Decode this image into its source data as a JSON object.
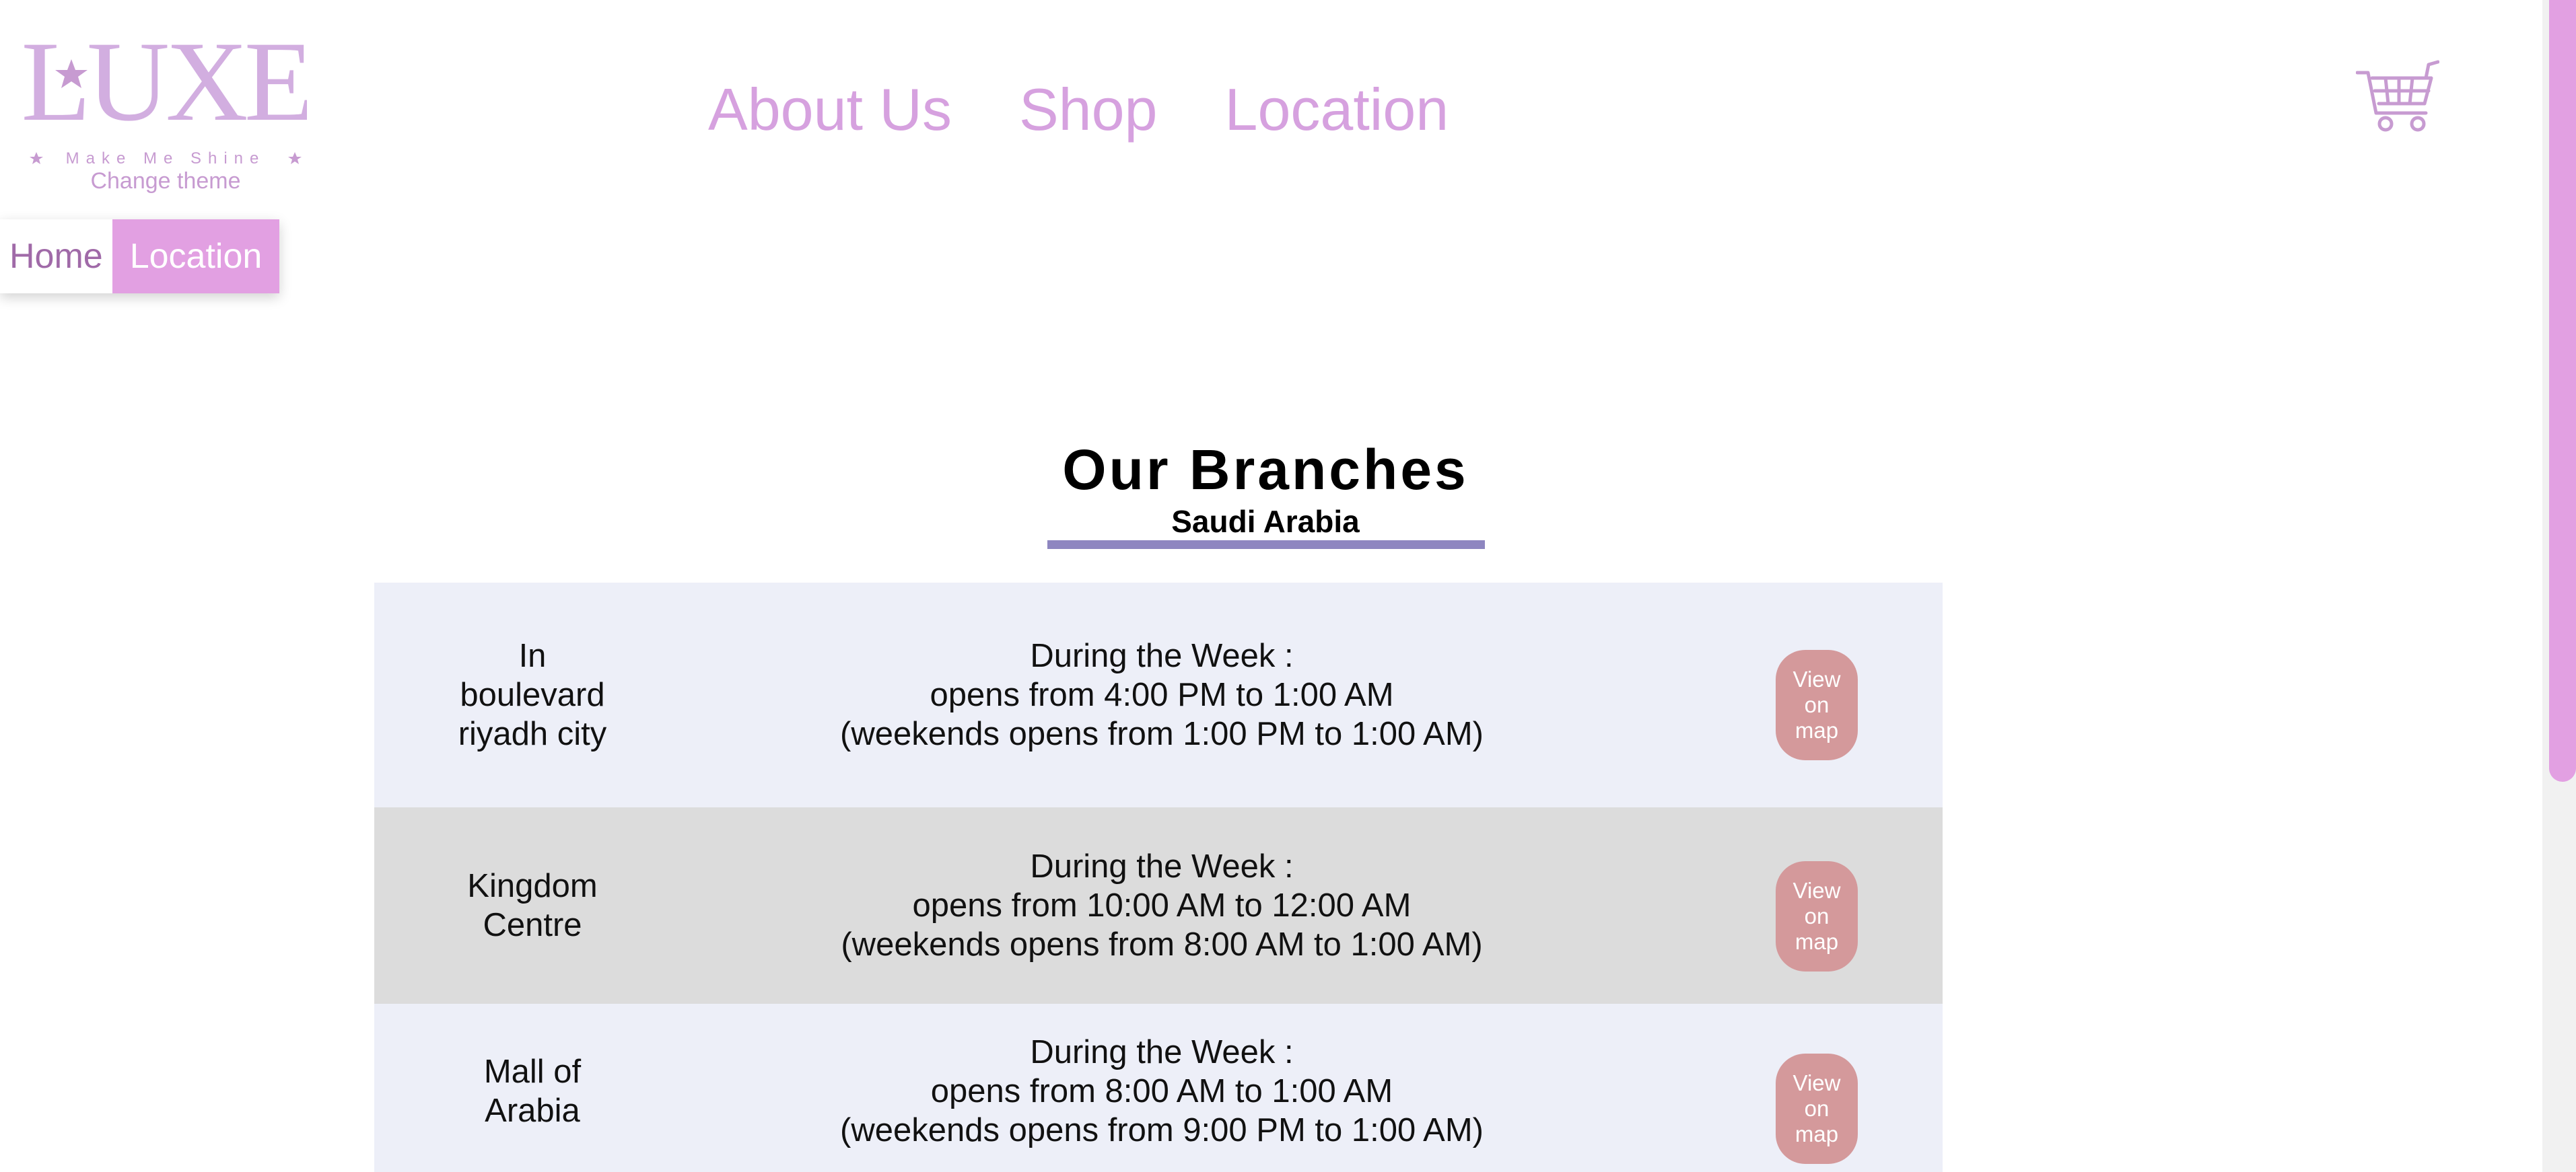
{
  "header": {
    "logo": {
      "wordmark": "LUXE",
      "tagline": "Make Me Shine"
    },
    "change_theme": "Change theme",
    "nav": [
      {
        "label": "About Us"
      },
      {
        "label": "Shop"
      },
      {
        "label": "Location"
      }
    ],
    "cart_icon": "shopping-cart-icon"
  },
  "breadcrumb": {
    "home": "Home",
    "current": "Location"
  },
  "main": {
    "title": "Our Branches",
    "subtitle": "Saudi Arabia",
    "branches": [
      {
        "name": "In boulevard riyadh city",
        "hours_heading": "During the Week :",
        "weekday": "opens from 4:00 PM to 1:00 AM",
        "weekend": "(weekends opens from 1:00 PM to 1:00 AM)",
        "button": "View on map"
      },
      {
        "name": "Kingdom Centre",
        "hours_heading": "During the Week :",
        "weekday": "opens from 10:00 AM to 12:00 AM",
        "weekend": "(weekends opens from 8:00 AM to 1:00 AM)",
        "button": "View on map"
      },
      {
        "name": "Mall of Arabia",
        "hours_heading": "During the Week :",
        "weekday": "opens from 8:00 AM to 1:00 AM",
        "weekend": "(weekends opens from 9:00 PM to 1:00 AM)",
        "button": "View on map"
      }
    ]
  },
  "colors": {
    "brand_lilac": "#d6a1df",
    "accent_pink": "#e2a0e2",
    "underline": "#8e86c0",
    "row_light": "#edeff8",
    "row_grey": "#dcdcdc",
    "map_button": "#d4999b"
  }
}
